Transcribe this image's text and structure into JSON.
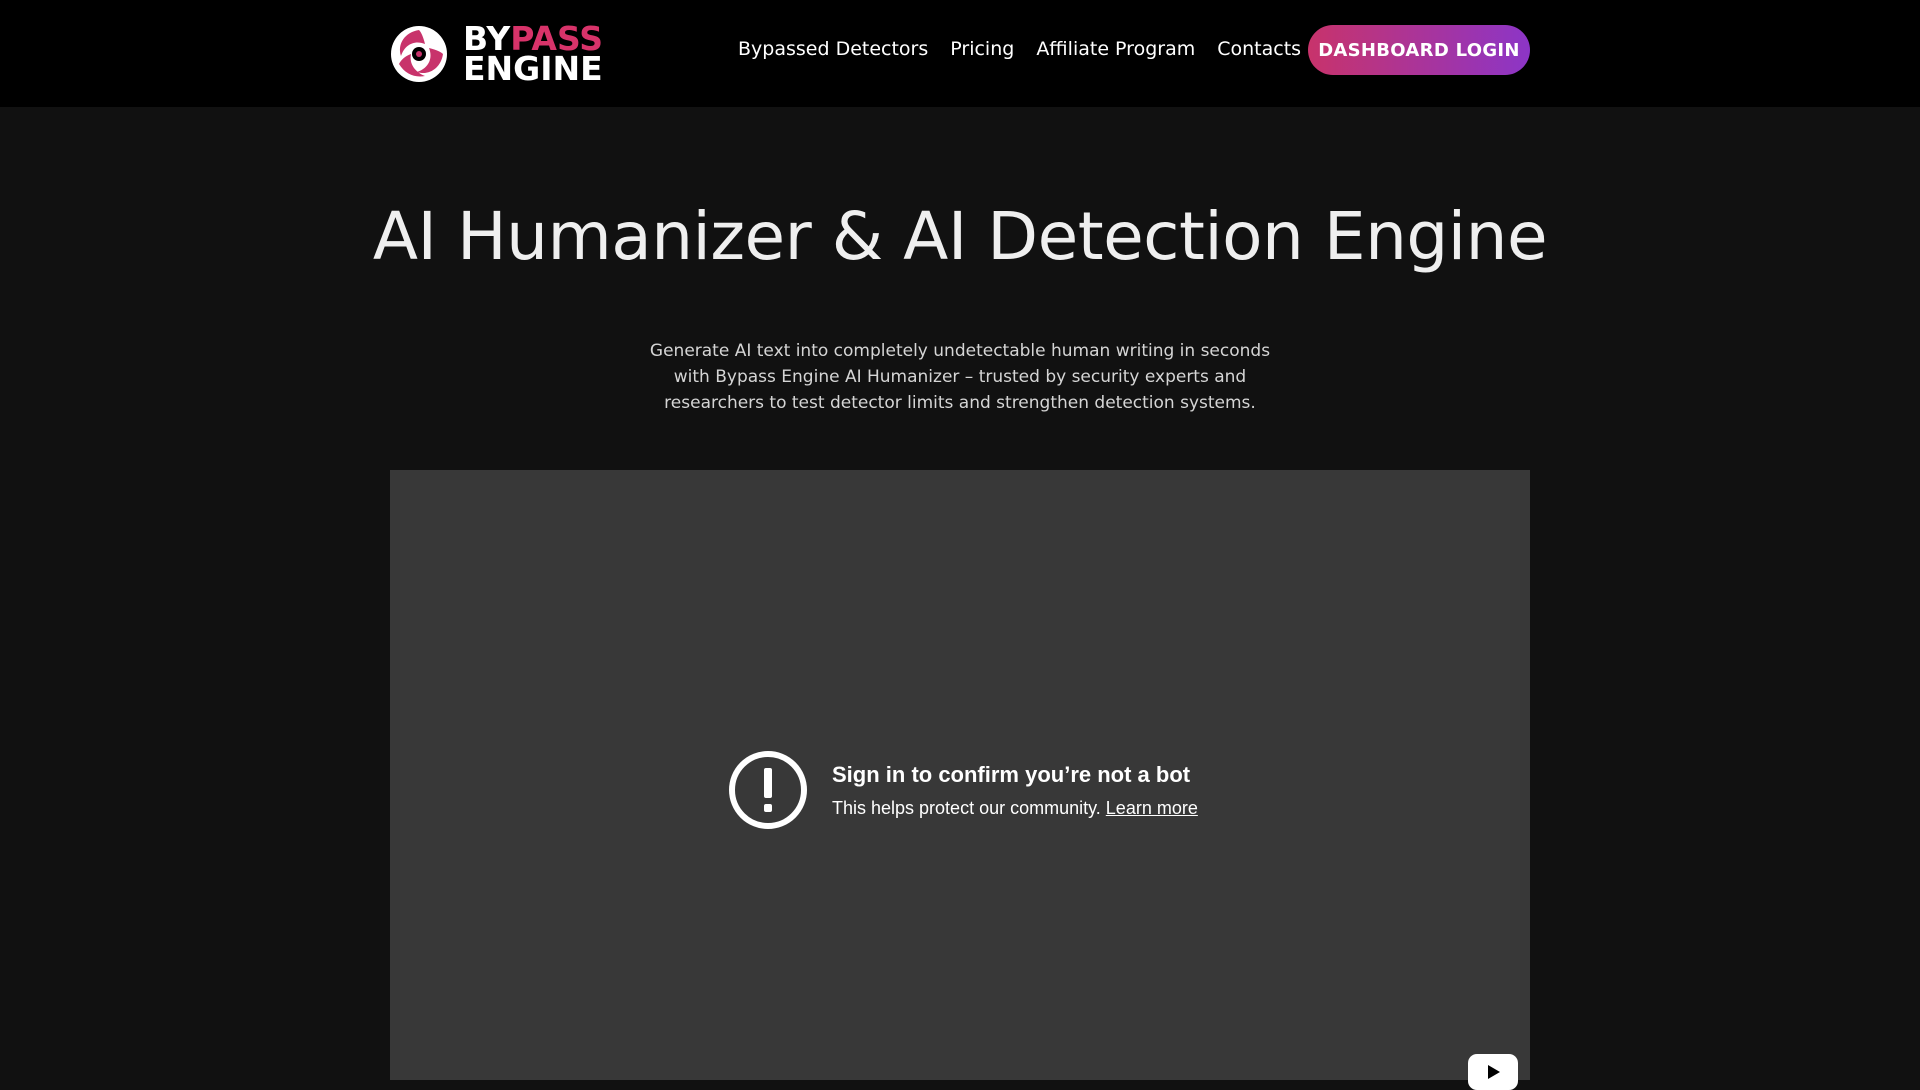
{
  "header": {
    "logo": {
      "line1_a": "BY",
      "line1_b": "PASS",
      "line2": "ENGINE"
    },
    "nav": [
      {
        "label": "Bypassed Detectors"
      },
      {
        "label": "Pricing"
      },
      {
        "label": "Affiliate Program"
      },
      {
        "label": "Contacts"
      }
    ],
    "login_label": "DASHBOARD LOGIN"
  },
  "hero": {
    "title": "AI Humanizer & AI Detection Engine",
    "subtitle": "Generate AI text into completely undetectable human writing in seconds with Bypass Engine AI Humanizer – trusted by security experts and researchers to test detector limits and strengthen detection systems."
  },
  "video": {
    "notice_title": "Sign in to confirm you’re not a bot",
    "notice_body": "This helps protect our community.",
    "learn_more": "Learn more",
    "icons": [
      "alert-circle-icon",
      "youtube-play-icon"
    ]
  },
  "colors": {
    "accent_start": "#c8336b",
    "accent_end": "#8c35c7",
    "brand_pink": "#d8336a",
    "background": "#111111",
    "video_bg": "#383838"
  }
}
